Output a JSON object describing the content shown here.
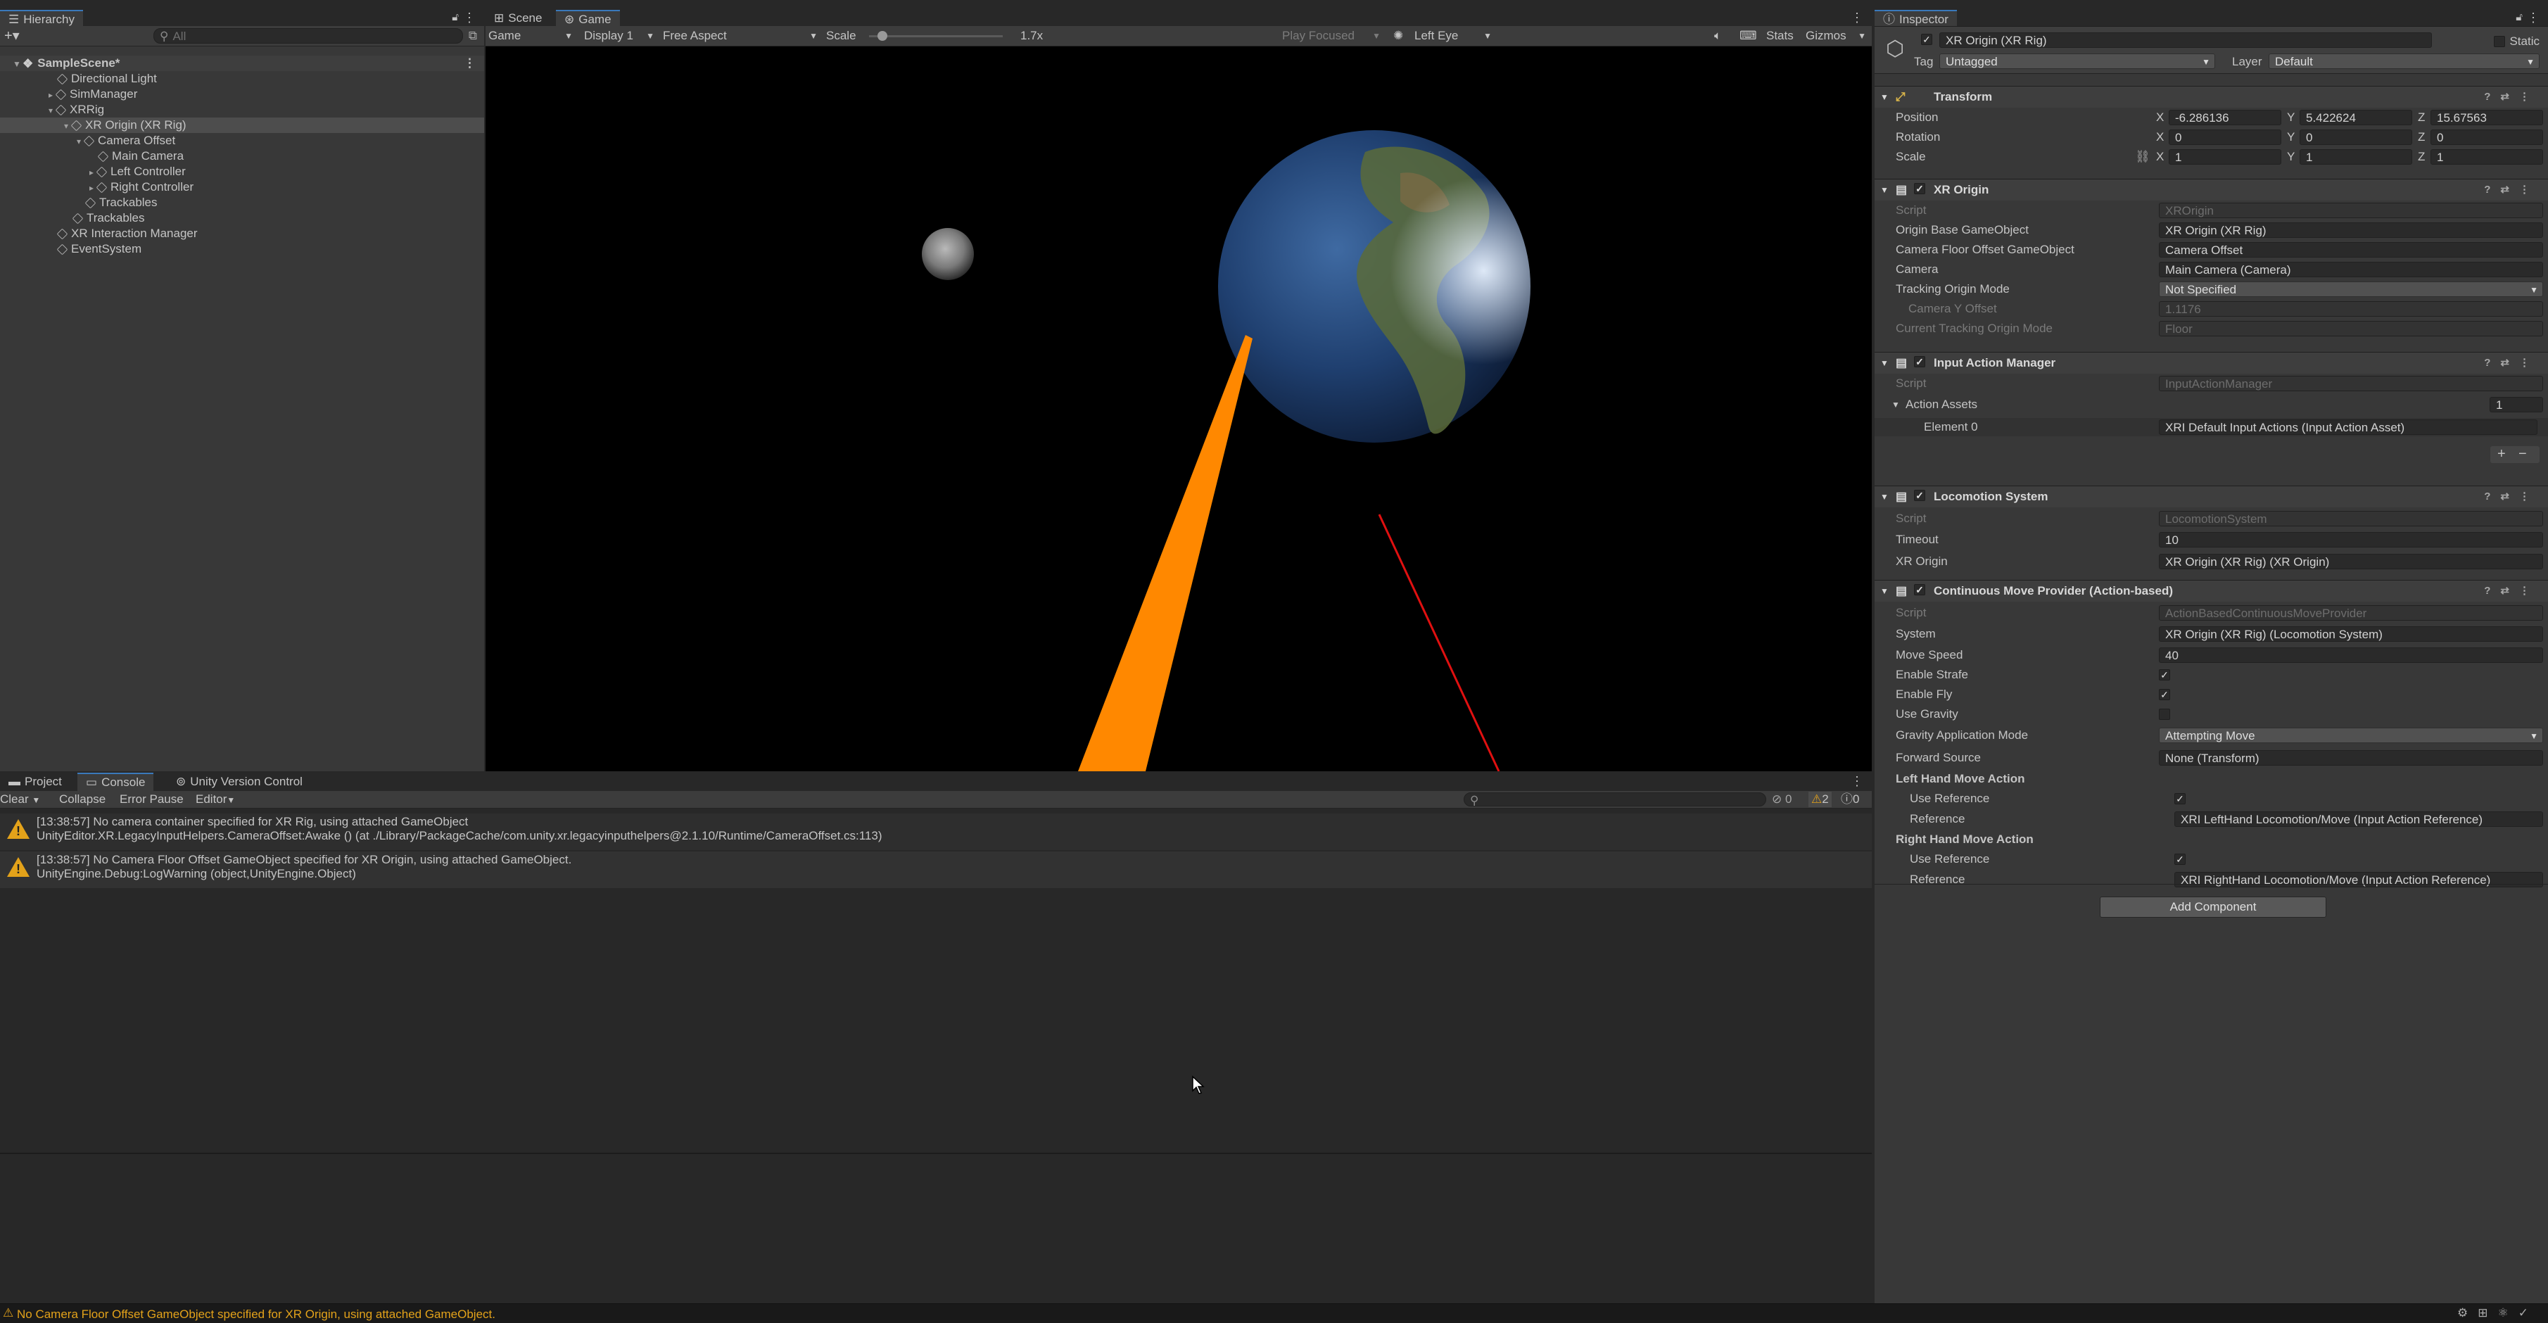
{
  "hierarchy": {
    "tab_label": "Hierarchy",
    "search_placeholder": "All",
    "items": [
      {
        "label": "SampleScene*"
      },
      {
        "label": "Directional Light"
      },
      {
        "label": "SimManager"
      },
      {
        "label": "XRRig"
      },
      {
        "label": "XR Origin (XR Rig)"
      },
      {
        "label": "Camera Offset"
      },
      {
        "label": "Main Camera"
      },
      {
        "label": "Left Controller"
      },
      {
        "label": "Right Controller"
      },
      {
        "label": "Trackables"
      },
      {
        "label": "Trackables"
      },
      {
        "label": "XR Interaction Manager"
      },
      {
        "label": "EventSystem"
      }
    ]
  },
  "view": {
    "tabs": [
      "Scene",
      "Game"
    ],
    "toolbar": {
      "game": "Game",
      "display": "Display 1",
      "aspect": "Free Aspect",
      "scale_label": "Scale",
      "scale_value": "1.7x",
      "play_focused": "Play Focused",
      "eye": "Left Eye",
      "stats": "Stats",
      "gizmos": "Gizmos"
    }
  },
  "bottom": {
    "tabs": [
      "Project",
      "Console",
      "Unity Version Control"
    ],
    "console_toolbar": {
      "clear": "Clear",
      "collapse": "Collapse",
      "error_pause": "Error Pause",
      "editor": "Editor",
      "count_error": "0",
      "count_warn": "2",
      "count_info": "0"
    },
    "messages": [
      {
        "line1": "[13:38:57] No camera container specified for XR Rig, using attached GameObject",
        "line2": "UnityEditor.XR.LegacyInputHelpers.CameraOffset:Awake () (at ./Library/PackageCache/com.unity.xr.legacyinputhelpers@2.1.10/Runtime/CameraOffset.cs:113)"
      },
      {
        "line1": "[13:38:57] No Camera Floor Offset GameObject specified for XR Origin, using attached GameObject.",
        "line2": "UnityEngine.Debug:LogWarning (object,UnityEngine.Object)"
      }
    ]
  },
  "status_bar": {
    "message": "No Camera Floor Offset GameObject specified for XR Origin, using attached GameObject."
  },
  "inspector": {
    "tab_label": "Inspector",
    "object_name": "XR Origin (XR Rig)",
    "static_label": "Static",
    "tag_label": "Tag",
    "tag_value": "Untagged",
    "layer_label": "Layer",
    "layer_value": "Default",
    "transform": {
      "title": "Transform",
      "position_label": "Position",
      "pos_x": "-6.286136",
      "pos_y": "5.422624",
      "pos_z": "15.67563",
      "rotation_label": "Rotation",
      "rot_x": "0",
      "rot_y": "0",
      "rot_z": "0",
      "scale_label": "Scale",
      "scale_x": "1",
      "scale_y": "1",
      "scale_z": "1",
      "axis_x": "X",
      "axis_y": "Y",
      "axis_z": "Z"
    },
    "xr_origin": {
      "title": "XR Origin",
      "script_label": "Script",
      "script_value": "XROrigin",
      "origin_base_label": "Origin Base GameObject",
      "origin_base_value": "XR Origin (XR Rig)",
      "floor_offset_label": "Camera Floor Offset GameObject",
      "floor_offset_value": "Camera Offset",
      "camera_label": "Camera",
      "camera_value": "Main Camera (Camera)",
      "tracking_label": "Tracking Origin Mode",
      "tracking_value": "Not Specified",
      "cam_y_label": "Camera Y Offset",
      "cam_y_value": "1.1176",
      "current_label": "Current Tracking Origin Mode",
      "current_value": "Floor"
    },
    "input_action_manager": {
      "title": "Input Action Manager",
      "script_label": "Script",
      "script_value": "InputActionManager",
      "assets_label": "Action Assets",
      "assets_count": "1",
      "element_label": "Element 0",
      "element_value": "XRI Default Input Actions (Input Action Asset)",
      "plus": "+",
      "minus": "−"
    },
    "locomotion": {
      "title": "Locomotion System",
      "script_label": "Script",
      "script_value": "LocomotionSystem",
      "timeout_label": "Timeout",
      "timeout_value": "10",
      "xr_origin_label": "XR Origin",
      "xr_origin_value": "XR Origin (XR Rig) (XR Origin)"
    },
    "move_provider": {
      "title": "Continuous Move Provider (Action-based)",
      "script_label": "Script",
      "script_value": "ActionBasedContinuousMoveProvider",
      "system_label": "System",
      "system_value": "XR Origin (XR Rig) (Locomotion System)",
      "speed_label": "Move Speed",
      "speed_value": "40",
      "strafe_label": "Enable Strafe",
      "fly_label": "Enable Fly",
      "gravity_label": "Use Gravity",
      "gravity_mode_label": "Gravity Application Mode",
      "gravity_mode_value": "Attempting Move",
      "forward_label": "Forward Source",
      "forward_value": "None (Transform)",
      "left_label": "Left Hand Move Action",
      "right_label": "Right Hand Move Action",
      "use_ref_label": "Use Reference",
      "ref_label": "Reference",
      "left_ref_value": "XRI LeftHand Locomotion/Move (Input Action Reference)",
      "right_ref_value": "XRI RightHand Locomotion/Move (Input Action Reference)"
    },
    "add_component": "Add Component"
  }
}
